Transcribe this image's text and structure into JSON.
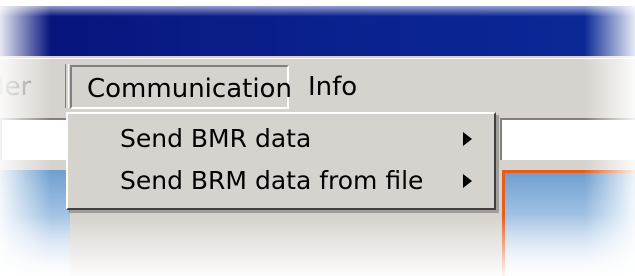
{
  "menubar": {
    "items": [
      {
        "label": "der"
      },
      {
        "label": "Communication"
      },
      {
        "label": "Info"
      }
    ]
  },
  "dropdown": {
    "items": [
      {
        "label": "Send BMR data",
        "icon": "submenu-arrow-icon"
      },
      {
        "label": "Send BRM data from file",
        "icon": "submenu-arrow-icon"
      }
    ]
  },
  "colors": {
    "titlebar": "#0a1f8c",
    "menu_bg": "#d6d3ce",
    "panel_blue": "#6f9fd0",
    "accent_orange": "#e85d1a"
  }
}
